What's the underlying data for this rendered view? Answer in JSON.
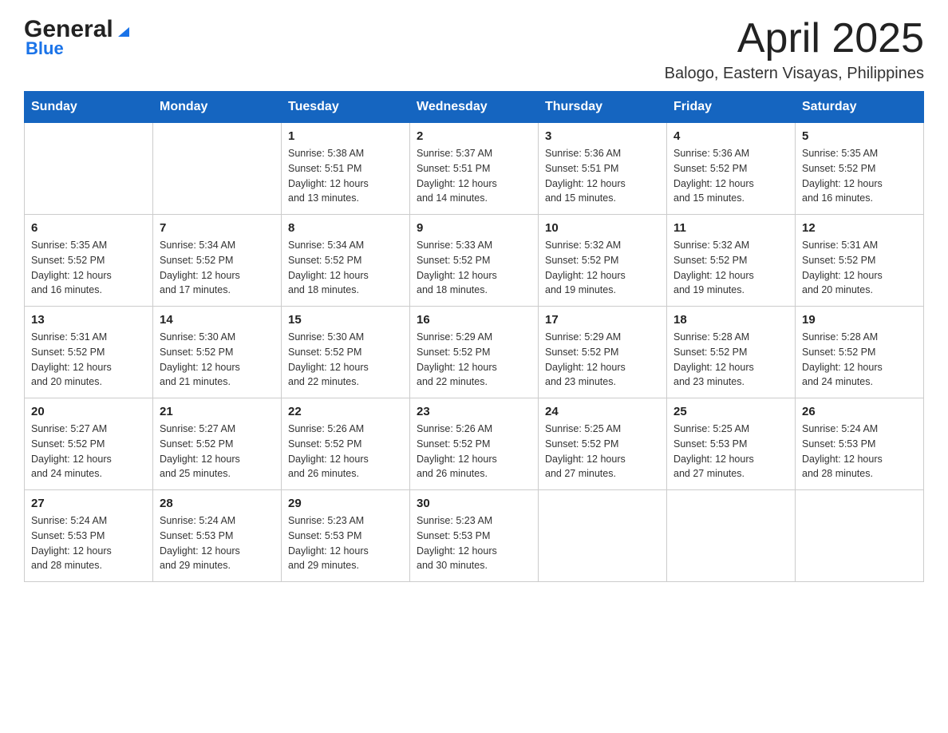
{
  "header": {
    "logo_general": "General",
    "logo_blue": "Blue",
    "title": "April 2025",
    "subtitle": "Balogo, Eastern Visayas, Philippines"
  },
  "calendar": {
    "days_of_week": [
      "Sunday",
      "Monday",
      "Tuesday",
      "Wednesday",
      "Thursday",
      "Friday",
      "Saturday"
    ],
    "weeks": [
      [
        {
          "day": "",
          "info": ""
        },
        {
          "day": "",
          "info": ""
        },
        {
          "day": "1",
          "info": "Sunrise: 5:38 AM\nSunset: 5:51 PM\nDaylight: 12 hours\nand 13 minutes."
        },
        {
          "day": "2",
          "info": "Sunrise: 5:37 AM\nSunset: 5:51 PM\nDaylight: 12 hours\nand 14 minutes."
        },
        {
          "day": "3",
          "info": "Sunrise: 5:36 AM\nSunset: 5:51 PM\nDaylight: 12 hours\nand 15 minutes."
        },
        {
          "day": "4",
          "info": "Sunrise: 5:36 AM\nSunset: 5:52 PM\nDaylight: 12 hours\nand 15 minutes."
        },
        {
          "day": "5",
          "info": "Sunrise: 5:35 AM\nSunset: 5:52 PM\nDaylight: 12 hours\nand 16 minutes."
        }
      ],
      [
        {
          "day": "6",
          "info": "Sunrise: 5:35 AM\nSunset: 5:52 PM\nDaylight: 12 hours\nand 16 minutes."
        },
        {
          "day": "7",
          "info": "Sunrise: 5:34 AM\nSunset: 5:52 PM\nDaylight: 12 hours\nand 17 minutes."
        },
        {
          "day": "8",
          "info": "Sunrise: 5:34 AM\nSunset: 5:52 PM\nDaylight: 12 hours\nand 18 minutes."
        },
        {
          "day": "9",
          "info": "Sunrise: 5:33 AM\nSunset: 5:52 PM\nDaylight: 12 hours\nand 18 minutes."
        },
        {
          "day": "10",
          "info": "Sunrise: 5:32 AM\nSunset: 5:52 PM\nDaylight: 12 hours\nand 19 minutes."
        },
        {
          "day": "11",
          "info": "Sunrise: 5:32 AM\nSunset: 5:52 PM\nDaylight: 12 hours\nand 19 minutes."
        },
        {
          "day": "12",
          "info": "Sunrise: 5:31 AM\nSunset: 5:52 PM\nDaylight: 12 hours\nand 20 minutes."
        }
      ],
      [
        {
          "day": "13",
          "info": "Sunrise: 5:31 AM\nSunset: 5:52 PM\nDaylight: 12 hours\nand 20 minutes."
        },
        {
          "day": "14",
          "info": "Sunrise: 5:30 AM\nSunset: 5:52 PM\nDaylight: 12 hours\nand 21 minutes."
        },
        {
          "day": "15",
          "info": "Sunrise: 5:30 AM\nSunset: 5:52 PM\nDaylight: 12 hours\nand 22 minutes."
        },
        {
          "day": "16",
          "info": "Sunrise: 5:29 AM\nSunset: 5:52 PM\nDaylight: 12 hours\nand 22 minutes."
        },
        {
          "day": "17",
          "info": "Sunrise: 5:29 AM\nSunset: 5:52 PM\nDaylight: 12 hours\nand 23 minutes."
        },
        {
          "day": "18",
          "info": "Sunrise: 5:28 AM\nSunset: 5:52 PM\nDaylight: 12 hours\nand 23 minutes."
        },
        {
          "day": "19",
          "info": "Sunrise: 5:28 AM\nSunset: 5:52 PM\nDaylight: 12 hours\nand 24 minutes."
        }
      ],
      [
        {
          "day": "20",
          "info": "Sunrise: 5:27 AM\nSunset: 5:52 PM\nDaylight: 12 hours\nand 24 minutes."
        },
        {
          "day": "21",
          "info": "Sunrise: 5:27 AM\nSunset: 5:52 PM\nDaylight: 12 hours\nand 25 minutes."
        },
        {
          "day": "22",
          "info": "Sunrise: 5:26 AM\nSunset: 5:52 PM\nDaylight: 12 hours\nand 26 minutes."
        },
        {
          "day": "23",
          "info": "Sunrise: 5:26 AM\nSunset: 5:52 PM\nDaylight: 12 hours\nand 26 minutes."
        },
        {
          "day": "24",
          "info": "Sunrise: 5:25 AM\nSunset: 5:52 PM\nDaylight: 12 hours\nand 27 minutes."
        },
        {
          "day": "25",
          "info": "Sunrise: 5:25 AM\nSunset: 5:53 PM\nDaylight: 12 hours\nand 27 minutes."
        },
        {
          "day": "26",
          "info": "Sunrise: 5:24 AM\nSunset: 5:53 PM\nDaylight: 12 hours\nand 28 minutes."
        }
      ],
      [
        {
          "day": "27",
          "info": "Sunrise: 5:24 AM\nSunset: 5:53 PM\nDaylight: 12 hours\nand 28 minutes."
        },
        {
          "day": "28",
          "info": "Sunrise: 5:24 AM\nSunset: 5:53 PM\nDaylight: 12 hours\nand 29 minutes."
        },
        {
          "day": "29",
          "info": "Sunrise: 5:23 AM\nSunset: 5:53 PM\nDaylight: 12 hours\nand 29 minutes."
        },
        {
          "day": "30",
          "info": "Sunrise: 5:23 AM\nSunset: 5:53 PM\nDaylight: 12 hours\nand 30 minutes."
        },
        {
          "day": "",
          "info": ""
        },
        {
          "day": "",
          "info": ""
        },
        {
          "day": "",
          "info": ""
        }
      ]
    ]
  }
}
